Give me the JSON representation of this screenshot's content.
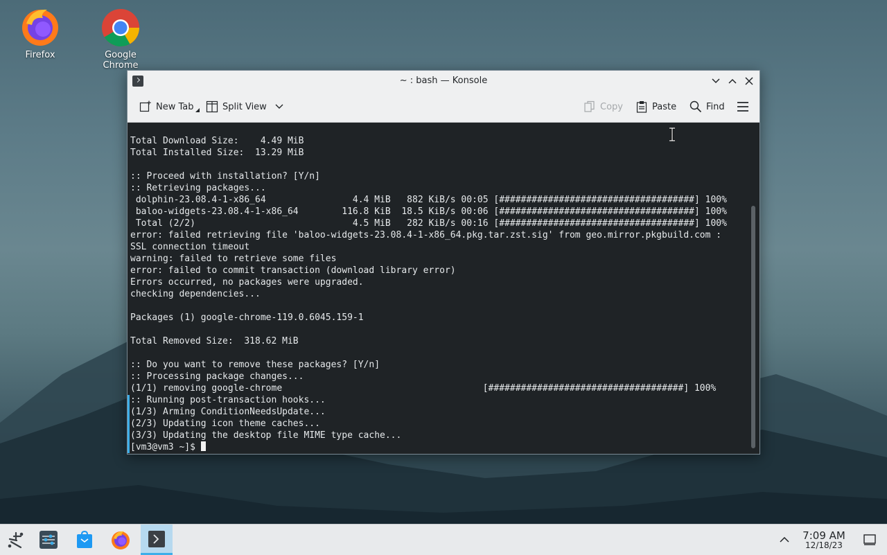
{
  "desktop": {
    "icons": [
      {
        "label": "Firefox",
        "icon": "firefox-icon"
      },
      {
        "label": "Google Chrome",
        "icon": "chrome-icon"
      }
    ]
  },
  "window": {
    "title": "~ : bash — Konsole",
    "toolbar": {
      "new_tab": "New Tab",
      "split_view": "Split View",
      "copy": "Copy",
      "paste": "Paste",
      "find": "Find"
    },
    "terminal_lines": [
      "Total Download Size:    4.49 MiB",
      "Total Installed Size:  13.29 MiB",
      "",
      ":: Proceed with installation? [Y/n]",
      ":: Retrieving packages...",
      " dolphin-23.08.4-1-x86_64                4.4 MiB   882 KiB/s 00:05 [####################################] 100%",
      " baloo-widgets-23.08.4-1-x86_64        116.8 KiB  18.5 KiB/s 00:06 [####################################] 100%",
      " Total (2/2)                             4.5 MiB   282 KiB/s 00:16 [####################################] 100%",
      "error: failed retrieving file 'baloo-widgets-23.08.4-1-x86_64.pkg.tar.zst.sig' from geo.mirror.pkgbuild.com :",
      "SSL connection timeout",
      "warning: failed to retrieve some files",
      "error: failed to commit transaction (download library error)",
      "Errors occurred, no packages were upgraded.",
      "checking dependencies...",
      "",
      "Packages (1) google-chrome-119.0.6045.159-1",
      "",
      "Total Removed Size:  318.62 MiB",
      "",
      ":: Do you want to remove these packages? [Y/n]",
      ":: Processing package changes...",
      "(1/1) removing google-chrome                                     [####################################] 100%",
      ":: Running post-transaction hooks...",
      "(1/3) Arming ConditionNeedsUpdate...",
      "(2/3) Updating icon theme caches...",
      "(3/3) Updating the desktop file MIME type cache..."
    ],
    "prompt": "[vm3@vm3 ~]$ "
  },
  "taskbar": {
    "items": [
      "application-launcher-icon",
      "settings-icon",
      "discover-icon",
      "firefox-icon",
      "konsole-icon"
    ],
    "time": "7:09 AM",
    "date": "12/18/23"
  }
}
